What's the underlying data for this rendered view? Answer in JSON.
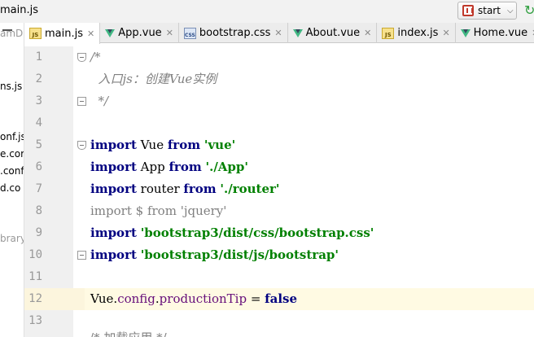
{
  "breadcrumb": "main.js",
  "run_config": {
    "label": "start"
  },
  "project_panel": {
    "items": [
      {
        "text": "amDa",
        "dim": true
      },
      {
        "text": "ns.js",
        "dim": false
      },
      {
        "text": "onf.js",
        "dim": false
      },
      {
        "text": "e.cor",
        "dim": false
      },
      {
        "text": ".conf",
        "dim": false
      },
      {
        "text": "d.co",
        "dim": false
      },
      {
        "text": "brary",
        "dim": true
      }
    ]
  },
  "tabs": [
    {
      "label": "main.js",
      "icon": "js-file-icon",
      "active": true
    },
    {
      "label": "App.vue",
      "icon": "vue-file-icon",
      "active": false
    },
    {
      "label": "bootstrap.css",
      "icon": "css-file-icon",
      "active": false
    },
    {
      "label": "About.vue",
      "icon": "vue-file-icon",
      "active": false
    },
    {
      "label": "index.js",
      "icon": "js-file-icon",
      "active": false
    },
    {
      "label": "Home.vue",
      "icon": "vue-file-icon",
      "active": false
    }
  ],
  "editor": {
    "line_numbers": [
      "1",
      "2",
      "3",
      "4",
      "5",
      "6",
      "7",
      "8",
      "9",
      "10",
      "11",
      "12",
      "13"
    ],
    "caret_line": "12",
    "lines": [
      [
        {
          "t": "/*",
          "c": "cmt"
        }
      ],
      [
        {
          "t": "  入口js：创建Vue实例",
          "c": "cmt"
        }
      ],
      [
        {
          "t": "  */",
          "c": "cmt"
        }
      ],
      [],
      [
        {
          "t": "import",
          "c": "kw"
        },
        {
          "t": " Vue ",
          "c": ""
        },
        {
          "t": "from",
          "c": "kw"
        },
        {
          "t": " ",
          "c": ""
        },
        {
          "t": "'vue'",
          "c": "str"
        }
      ],
      [
        {
          "t": "import",
          "c": "kw"
        },
        {
          "t": " App ",
          "c": ""
        },
        {
          "t": "from",
          "c": "kw"
        },
        {
          "t": " ",
          "c": ""
        },
        {
          "t": "'./App'",
          "c": "str"
        }
      ],
      [
        {
          "t": "import",
          "c": "kw"
        },
        {
          "t": " router ",
          "c": ""
        },
        {
          "t": "from",
          "c": "kw"
        },
        {
          "t": " ",
          "c": ""
        },
        {
          "t": "'./router'",
          "c": "str"
        }
      ],
      [
        {
          "t": "import",
          "c": "faded-kw"
        },
        {
          "t": " $ ",
          "c": "faded"
        },
        {
          "t": "from",
          "c": "faded-kw"
        },
        {
          "t": " ",
          "c": ""
        },
        {
          "t": "'jquery'",
          "c": "faded"
        }
      ],
      [
        {
          "t": "import",
          "c": "kw"
        },
        {
          "t": " ",
          "c": ""
        },
        {
          "t": "'bootstrap3/dist/css/bootstrap.css'",
          "c": "str"
        }
      ],
      [
        {
          "t": "import",
          "c": "kw"
        },
        {
          "t": " ",
          "c": ""
        },
        {
          "t": "'bootstrap3/dist/js/bootstrap'",
          "c": "str"
        }
      ],
      [],
      [
        {
          "t": "Vue.",
          "c": ""
        },
        {
          "t": "config",
          "c": "prop"
        },
        {
          "t": ".",
          "c": ""
        },
        {
          "t": "productionTip",
          "c": "prop"
        },
        {
          "t": " = ",
          "c": ""
        },
        {
          "t": "false",
          "c": "kw"
        }
      ],
      []
    ],
    "bottom_peek": "/* 加载应用 */"
  },
  "colors": {
    "keyword": "#000080",
    "string": "#008000",
    "comment": "#808080",
    "property": "#660e7a",
    "caret_row": "#fffae3"
  }
}
